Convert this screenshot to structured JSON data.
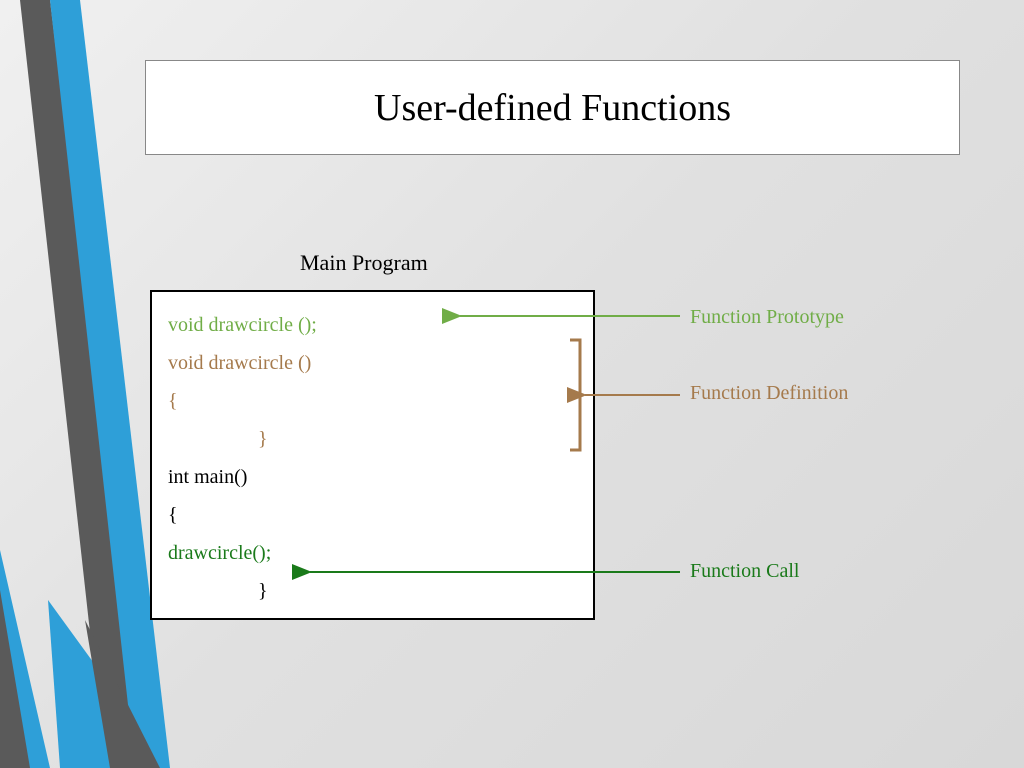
{
  "title": "User-defined Functions",
  "subtitle": "Main Program",
  "code": {
    "line1": "void drawcircle ();",
    "line2": "void drawcircle ()",
    "line3": "{",
    "line4": "}",
    "line5": "int main()",
    "line6": "{",
    "line7": "drawcircle();",
    "line8": "}"
  },
  "labels": {
    "prototype": "Function Prototype",
    "definition": "Function Definition",
    "call": "Function Call"
  },
  "colors": {
    "stripe_blue": "#2e9fd8",
    "stripe_gray": "#5a5a5a",
    "green_light": "#70ad47",
    "brown": "#a57a4c",
    "green_dark": "#1a7a1a"
  }
}
